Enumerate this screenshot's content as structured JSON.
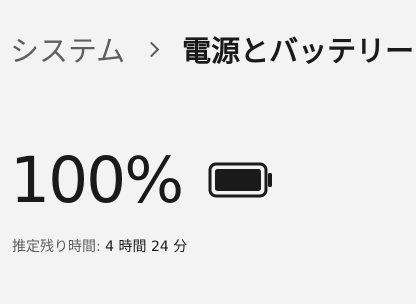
{
  "breadcrumb": {
    "parent": "システム",
    "current": "電源とバッテリー"
  },
  "battery": {
    "percent_text": "100%",
    "level": 1.0,
    "estimate_label": "推定残り時間:",
    "estimate_value": "4 時間 24 分"
  },
  "icons": {
    "separator": "chevron-right-icon",
    "battery": "battery-full-icon"
  }
}
